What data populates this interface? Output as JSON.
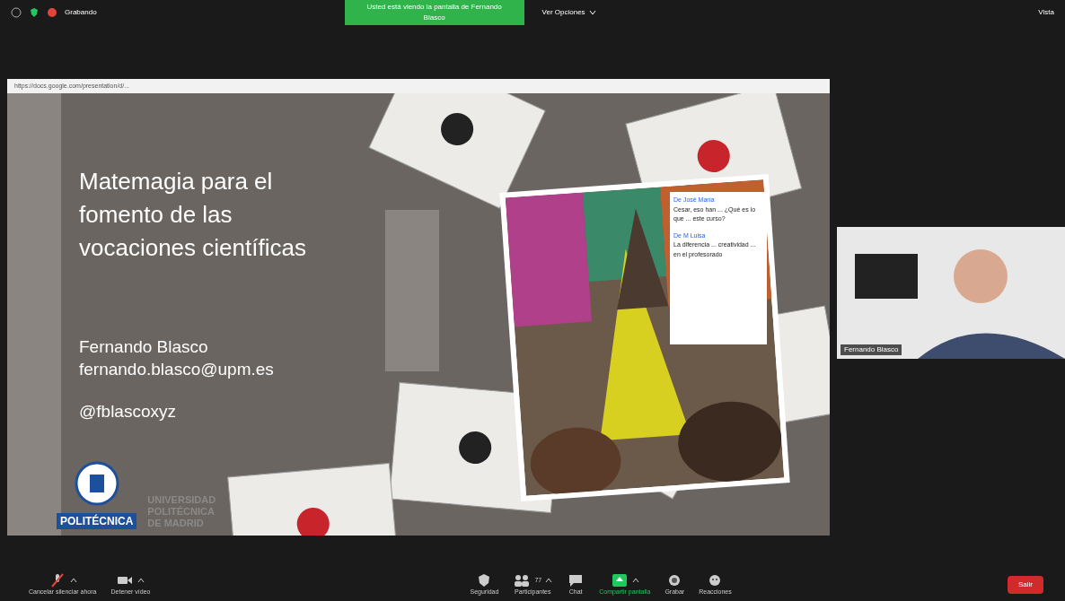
{
  "top_bar": {
    "recording_label": "Grabando",
    "sharing_banner": "Usted está viendo la pantalla de Fernando Blasco",
    "view_options": "Ver Opciones",
    "view_button": "Vista"
  },
  "browser": {
    "url": "https://docs.google.com/presentation/d/..."
  },
  "slide": {
    "title": "Matemagia para el fomento de las vocaciones científicas",
    "author": "Fernando Blasco",
    "email": "fernando.blasco@upm.es",
    "handle": "@fblascoxyz",
    "logo_label": "POLITÉCNICA",
    "university_lines": [
      "UNIVERSIDAD",
      "POLITÉCNICA",
      "DE MADRID"
    ],
    "chat": [
      {
        "sender": "De José María",
        "text": "Cesar, eso han ... ¿Qué es lo que ... este curso?"
      },
      {
        "sender": "De M Luisa",
        "text": "La diferencia ... creatividad ... en el profesorado"
      }
    ]
  },
  "participant": {
    "name": "Fernando Blasco"
  },
  "toolbar": [
    {
      "kind": "mic",
      "label": "Cancelar silenciar ahora",
      "caret": true
    },
    {
      "kind": "video",
      "label": "Detener vídeo",
      "caret": true
    },
    {
      "kind": "security",
      "label": "Seguridad",
      "caret": false
    },
    {
      "kind": "participants",
      "label": "Participantes",
      "count": "77",
      "caret": true
    },
    {
      "kind": "chat",
      "label": "Chat",
      "caret": false
    },
    {
      "kind": "share",
      "label": "Compartir pantalla",
      "caret": true
    },
    {
      "kind": "record",
      "label": "Grabar",
      "caret": false
    },
    {
      "kind": "reactions",
      "label": "Reacciones",
      "caret": false
    }
  ],
  "leave_button": "Salir"
}
